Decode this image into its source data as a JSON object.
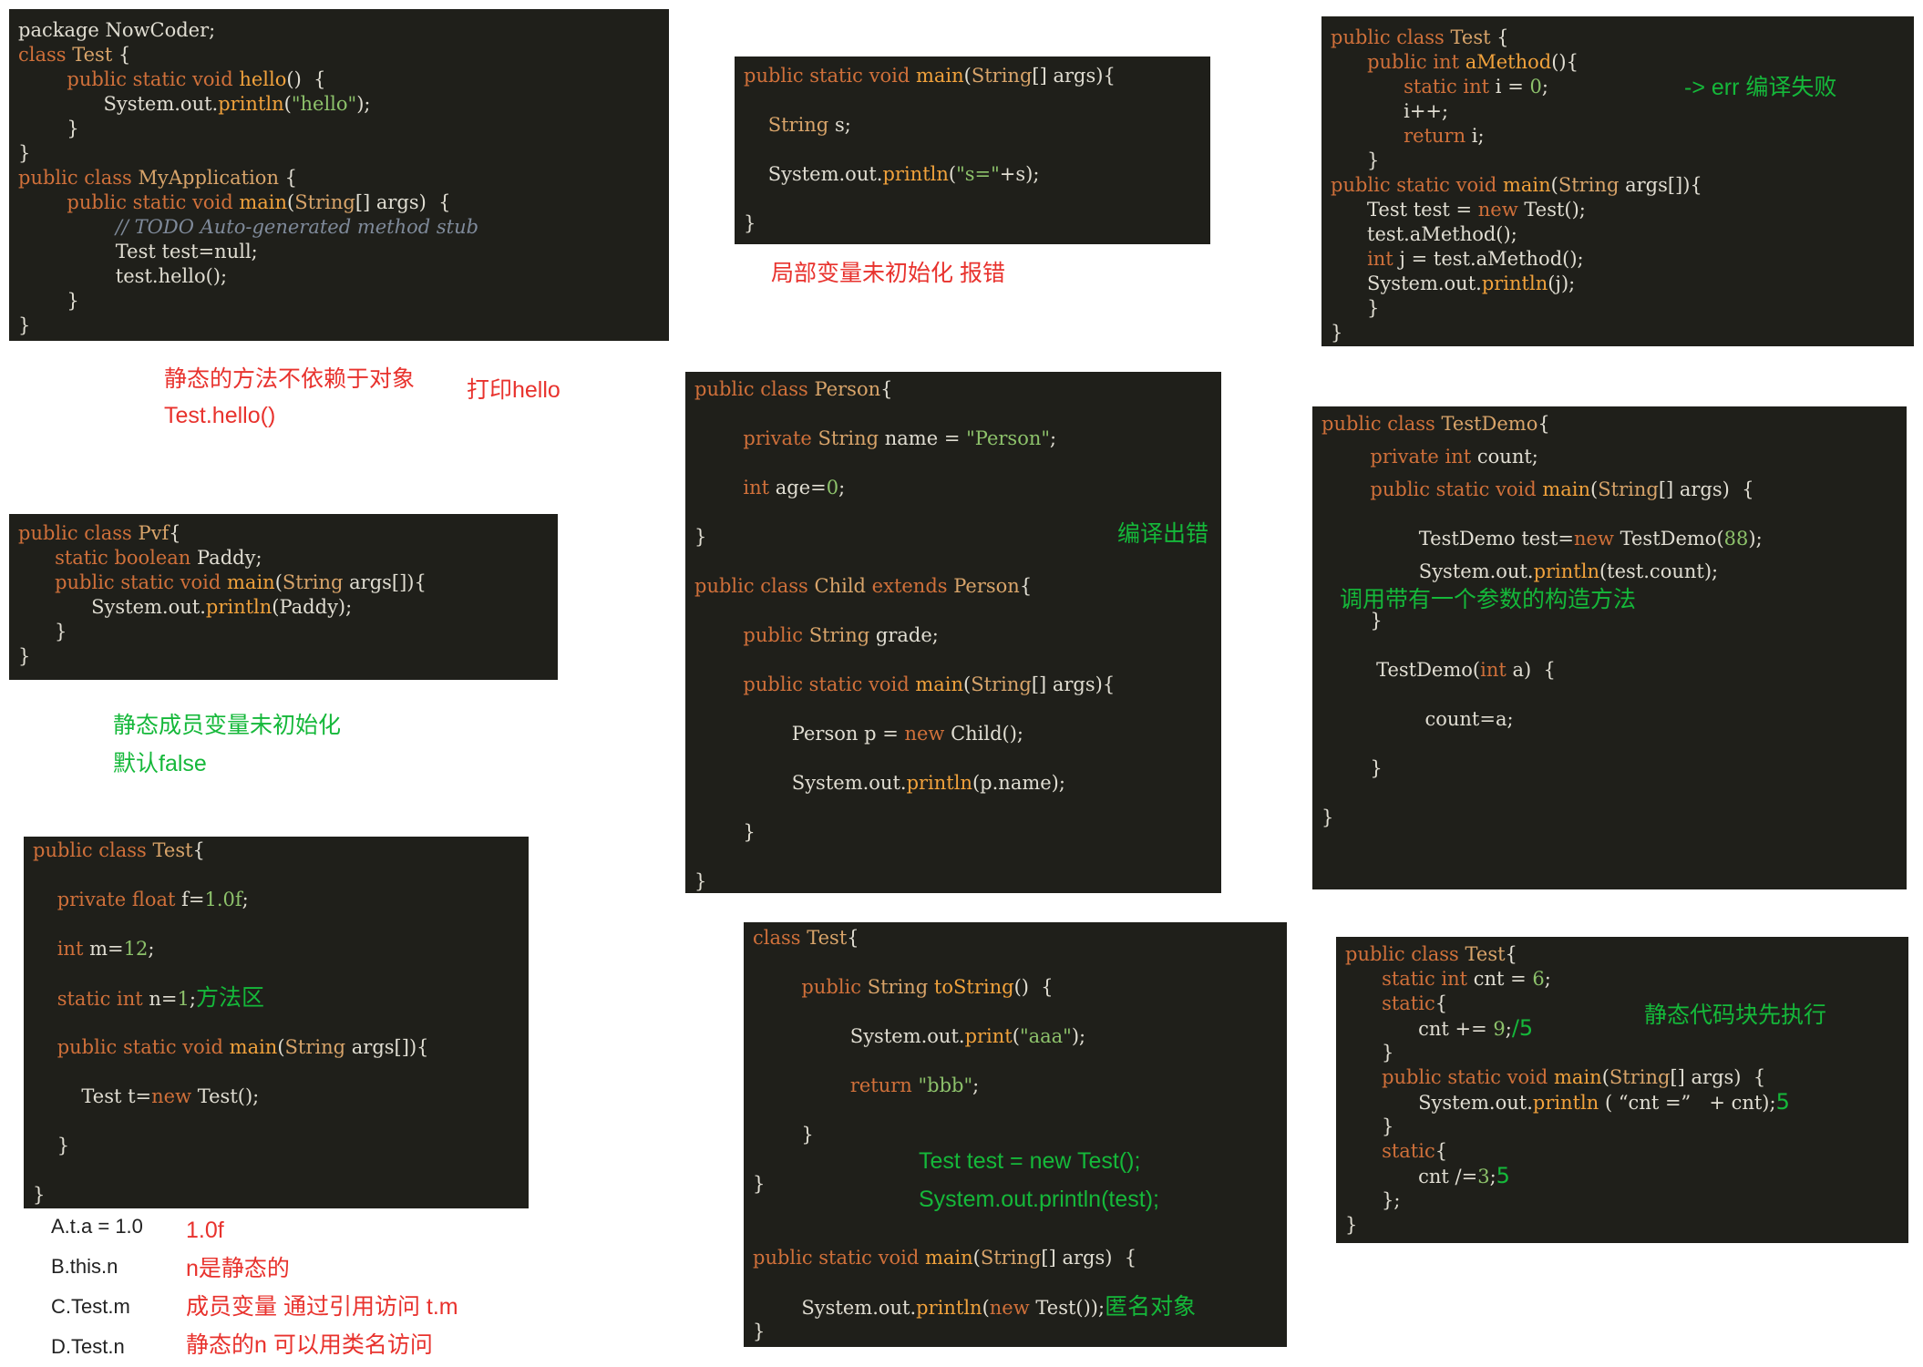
{
  "panels": [
    {
      "id": "p1",
      "lines": [
        [
          [
            "b",
            "package NowCoder;"
          ]
        ],
        [
          [
            "k",
            "class "
          ],
          [
            "t",
            "Test "
          ],
          [
            "b",
            "{"
          ]
        ],
        [
          [
            "b",
            "        "
          ],
          [
            "k",
            "public static void "
          ],
          [
            "m",
            "hello"
          ],
          [
            "b",
            "()  {"
          ]
        ],
        [
          [
            "b",
            "              System.out."
          ],
          [
            "m",
            "println"
          ],
          [
            "b",
            "("
          ],
          [
            "s",
            "\"hello\""
          ],
          [
            "b",
            ");"
          ]
        ],
        [
          [
            "b",
            "        }"
          ]
        ],
        [
          [
            "b",
            "}"
          ]
        ],
        [
          [
            "k",
            "public class "
          ],
          [
            "t",
            "MyApplication "
          ],
          [
            "b",
            "{"
          ]
        ],
        [
          [
            "b",
            "        "
          ],
          [
            "k",
            "public static void "
          ],
          [
            "m",
            "main"
          ],
          [
            "b",
            "("
          ],
          [
            "t",
            "String"
          ],
          [
            "b",
            "[] args)  {"
          ]
        ],
        [
          [
            "b",
            "                "
          ],
          [
            "c",
            "// TODO Auto-generated method stub"
          ]
        ],
        [
          [
            "b",
            "                Test test=null;"
          ]
        ],
        [
          [
            "b",
            "                test.hello();"
          ]
        ],
        [
          [
            "b",
            "        }"
          ]
        ],
        [
          [
            "b",
            "}"
          ]
        ]
      ]
    },
    {
      "id": "p2",
      "lines": [
        [
          [
            "k",
            "public static void "
          ],
          [
            "m",
            "main"
          ],
          [
            "b",
            "("
          ],
          [
            "t",
            "String"
          ],
          [
            "b",
            "[] args){"
          ]
        ],
        [],
        [
          [
            "b",
            "    "
          ],
          [
            "t",
            "String "
          ],
          [
            "b",
            "s;"
          ]
        ],
        [],
        [
          [
            "b",
            "    System.out."
          ],
          [
            "m",
            "println"
          ],
          [
            "b",
            "("
          ],
          [
            "s",
            "\"s=\""
          ],
          [
            "b",
            "+s);"
          ]
        ],
        [],
        [
          [
            "b",
            "}"
          ]
        ]
      ]
    },
    {
      "id": "p3",
      "lines": [
        [
          [
            "k",
            "public class "
          ],
          [
            "t",
            "Test "
          ],
          [
            "b",
            "{"
          ]
        ],
        [
          [
            "b",
            "      "
          ],
          [
            "k",
            "public int "
          ],
          [
            "m",
            "aMethod"
          ],
          [
            "b",
            "(){"
          ]
        ],
        [
          [
            "b",
            "            "
          ],
          [
            "k",
            "static int "
          ],
          [
            "b",
            "i = "
          ],
          [
            "n",
            "0"
          ],
          [
            "b",
            ";"
          ]
        ],
        [
          [
            "b",
            "            i++;"
          ]
        ],
        [
          [
            "b",
            "            "
          ],
          [
            "k",
            "return "
          ],
          [
            "b",
            "i;"
          ]
        ],
        [
          [
            "b",
            "      }"
          ]
        ],
        [
          [
            "k",
            "public static void "
          ],
          [
            "m",
            "main"
          ],
          [
            "b",
            "("
          ],
          [
            "t",
            "String "
          ],
          [
            "b",
            "args[]){"
          ]
        ],
        [
          [
            "b",
            "      Test test = "
          ],
          [
            "k",
            "new "
          ],
          [
            "b",
            "Test();"
          ]
        ],
        [
          [
            "b",
            "      test.aMethod();"
          ]
        ],
        [
          [
            "b",
            "      "
          ],
          [
            "k",
            "int "
          ],
          [
            "b",
            "j = test.aMethod();"
          ]
        ],
        [
          [
            "b",
            "      System.out."
          ],
          [
            "m",
            "println"
          ],
          [
            "b",
            "(j);"
          ]
        ],
        [
          [
            "b",
            "      }"
          ]
        ],
        [
          [
            "b",
            "}"
          ]
        ]
      ]
    },
    {
      "id": "p4",
      "lines": [
        [
          [
            "k",
            "public class "
          ],
          [
            "t",
            "Pvf"
          ],
          [
            "b",
            "{"
          ]
        ],
        [
          [
            "b",
            "      "
          ],
          [
            "k",
            "static boolean "
          ],
          [
            "b",
            "Paddy;"
          ]
        ],
        [
          [
            "b",
            "      "
          ],
          [
            "k",
            "public static void "
          ],
          [
            "m",
            "main"
          ],
          [
            "b",
            "("
          ],
          [
            "t",
            "String "
          ],
          [
            "b",
            "args[]){"
          ]
        ],
        [
          [
            "b",
            "            System.out."
          ],
          [
            "m",
            "println"
          ],
          [
            "b",
            "(Paddy);"
          ]
        ],
        [
          [
            "b",
            "      }"
          ]
        ],
        [
          [
            "b",
            "}"
          ]
        ]
      ]
    },
    {
      "id": "p5",
      "lines": [
        [
          [
            "k",
            "public class "
          ],
          [
            "t",
            "Person"
          ],
          [
            "b",
            "{"
          ]
        ],
        [],
        [
          [
            "b",
            "        "
          ],
          [
            "k",
            "private "
          ],
          [
            "t",
            "String "
          ],
          [
            "b",
            "name = "
          ],
          [
            "s",
            "\"Person\""
          ],
          [
            "b",
            ";"
          ]
        ],
        [],
        [
          [
            "b",
            "        "
          ],
          [
            "k",
            "int "
          ],
          [
            "b",
            "age="
          ],
          [
            "n",
            "0"
          ],
          [
            "b",
            ";"
          ]
        ],
        [],
        [
          [
            "b",
            "}"
          ]
        ],
        [],
        [
          [
            "k",
            "public class "
          ],
          [
            "t",
            "Child "
          ],
          [
            "k",
            "extends "
          ],
          [
            "t",
            "Person"
          ],
          [
            "b",
            "{"
          ]
        ],
        [],
        [
          [
            "b",
            "        "
          ],
          [
            "k",
            "public "
          ],
          [
            "t",
            "String "
          ],
          [
            "b",
            "grade;"
          ]
        ],
        [],
        [
          [
            "b",
            "        "
          ],
          [
            "k",
            "public static void "
          ],
          [
            "m",
            "main"
          ],
          [
            "b",
            "("
          ],
          [
            "t",
            "String"
          ],
          [
            "b",
            "[] args){"
          ]
        ],
        [],
        [
          [
            "b",
            "                Person p = "
          ],
          [
            "k",
            "new "
          ],
          [
            "b",
            "Child();"
          ]
        ],
        [],
        [
          [
            "b",
            "                System.out."
          ],
          [
            "m",
            "println"
          ],
          [
            "b",
            "(p.name);"
          ]
        ],
        [],
        [
          [
            "b",
            "        }"
          ]
        ],
        [],
        [
          [
            "b",
            "}"
          ]
        ]
      ]
    },
    {
      "id": "p6",
      "lines": [
        [
          [
            "k",
            "public class "
          ],
          [
            "t",
            "TestDemo"
          ],
          [
            "b",
            "{"
          ]
        ],
        [],
        [
          [
            "b",
            "        "
          ],
          [
            "k",
            "private int "
          ],
          [
            "b",
            "count;"
          ]
        ],
        [],
        [
          [
            "b",
            "        "
          ],
          [
            "k",
            "public static void "
          ],
          [
            "m",
            "main"
          ],
          [
            "b",
            "("
          ],
          [
            "t",
            "String"
          ],
          [
            "b",
            "[] args)  {"
          ]
        ],
        [],
        [],
        [
          [
            "b",
            "                TestDemo test="
          ],
          [
            "k",
            "new "
          ],
          [
            "b",
            "TestDemo("
          ],
          [
            "n",
            "88"
          ],
          [
            "b",
            ");"
          ]
        ],
        [],
        [
          [
            "b",
            "                System.out."
          ],
          [
            "m",
            "println"
          ],
          [
            "b",
            "(test.count);"
          ]
        ],
        [],
        [],
        [
          [
            "b",
            "        }"
          ]
        ],
        [],
        [],
        [
          [
            "b",
            "         TestDemo("
          ],
          [
            "k",
            "int "
          ],
          [
            "b",
            "a)  {"
          ]
        ],
        [],
        [],
        [
          [
            "b",
            "                 count=a;"
          ]
        ],
        [],
        [],
        [
          [
            "b",
            "        }"
          ]
        ],
        [],
        [],
        [
          [
            "b",
            "}"
          ]
        ]
      ]
    },
    {
      "id": "p7",
      "lines": [
        [
          [
            "k",
            "public class "
          ],
          [
            "t",
            "Test"
          ],
          [
            "b",
            "{"
          ]
        ],
        [],
        [
          [
            "b",
            "    "
          ],
          [
            "k",
            "private float "
          ],
          [
            "b",
            "f="
          ],
          [
            "n",
            "1.0f"
          ],
          [
            "b",
            ";"
          ]
        ],
        [],
        [
          [
            "b",
            "    "
          ],
          [
            "k",
            "int "
          ],
          [
            "b",
            "m="
          ],
          [
            "n",
            "12"
          ],
          [
            "b",
            ";"
          ]
        ],
        [],
        [
          [
            "b",
            "    "
          ],
          [
            "k",
            "static int "
          ],
          [
            "b",
            "n="
          ],
          [
            "n",
            "1"
          ],
          [
            "b",
            ";"
          ],
          [
            "note",
            "方法区"
          ]
        ],
        [],
        [
          [
            "b",
            "    "
          ],
          [
            "k",
            "public static void "
          ],
          [
            "m",
            "main"
          ],
          [
            "b",
            "("
          ],
          [
            "t",
            "String "
          ],
          [
            "b",
            "args[]){"
          ]
        ],
        [],
        [
          [
            "b",
            "        Test t="
          ],
          [
            "k",
            "new "
          ],
          [
            "b",
            "Test();"
          ]
        ],
        [],
        [
          [
            "b",
            "    }"
          ]
        ],
        [],
        [
          [
            "b",
            "}"
          ]
        ]
      ]
    },
    {
      "id": "p8",
      "lines": [
        [
          [
            "k",
            "class "
          ],
          [
            "t",
            "Test"
          ],
          [
            "b",
            "{"
          ]
        ],
        [],
        [
          [
            "b",
            "        "
          ],
          [
            "k",
            "public "
          ],
          [
            "t",
            "String "
          ],
          [
            "m",
            "toString"
          ],
          [
            "b",
            "()  {"
          ]
        ],
        [],
        [
          [
            "b",
            "                System.out."
          ],
          [
            "m",
            "print"
          ],
          [
            "b",
            "("
          ],
          [
            "s",
            "\"aaa\""
          ],
          [
            "b",
            ");"
          ]
        ],
        [],
        [
          [
            "b",
            "                "
          ],
          [
            "k",
            "return "
          ],
          [
            "s",
            "\"bbb\""
          ],
          [
            "b",
            ";"
          ]
        ],
        [],
        [
          [
            "b",
            "        }"
          ]
        ],
        [],
        [
          [
            "b",
            "}"
          ]
        ],
        [],
        [],
        [
          [
            "k",
            "public static void "
          ],
          [
            "m",
            "main"
          ],
          [
            "b",
            "("
          ],
          [
            "t",
            "String"
          ],
          [
            "b",
            "[] args)  {"
          ]
        ],
        [],
        [
          [
            "b",
            "        System.out."
          ],
          [
            "m",
            "println"
          ],
          [
            "b",
            "("
          ],
          [
            "k",
            "new "
          ],
          [
            "b",
            "Test());"
          ],
          [
            "note",
            "匿名对象"
          ]
        ],
        [
          [
            "b",
            "}"
          ]
        ]
      ]
    },
    {
      "id": "p9",
      "lines": [
        [
          [
            "k",
            "public class "
          ],
          [
            "t",
            "Test"
          ],
          [
            "b",
            "{"
          ]
        ],
        [
          [
            "b",
            "      "
          ],
          [
            "k",
            "static int "
          ],
          [
            "b",
            "cnt = "
          ],
          [
            "n",
            "6"
          ],
          [
            "b",
            ";"
          ]
        ],
        [
          [
            "b",
            "      "
          ],
          [
            "k",
            "static"
          ],
          [
            "b",
            "{"
          ]
        ],
        [
          [
            "b",
            "            cnt += "
          ],
          [
            "n",
            "9"
          ],
          [
            "b",
            ";"
          ],
          [
            "sw",
            "/5"
          ]
        ],
        [
          [
            "b",
            "      }"
          ]
        ],
        [
          [
            "b",
            "      "
          ],
          [
            "k",
            "public static void "
          ],
          [
            "m",
            "main"
          ],
          [
            "b",
            "("
          ],
          [
            "t",
            "String"
          ],
          [
            "b",
            "[] args)  {"
          ]
        ],
        [
          [
            "b",
            "            System.out."
          ],
          [
            "m",
            "println "
          ],
          [
            "b",
            "( “cnt =”   + cnt);"
          ],
          [
            "sw",
            "5"
          ]
        ],
        [
          [
            "b",
            "      }"
          ]
        ],
        [
          [
            "b",
            "      "
          ],
          [
            "k",
            "static"
          ],
          [
            "b",
            "{"
          ]
        ],
        [
          [
            "b",
            "            cnt /="
          ],
          [
            "n",
            "3"
          ],
          [
            "b",
            ";"
          ],
          [
            "sw",
            "5"
          ]
        ],
        [
          [
            "b",
            "      };"
          ]
        ],
        [
          [
            "b",
            "}"
          ]
        ]
      ]
    }
  ],
  "notes": {
    "n1": "静态的方法不依赖于对象",
    "n2": "Test.hello()",
    "n3": "打印hello",
    "n4": "局部变量未初始化 报错",
    "n5": "-> err  编译失败",
    "n6": "编译出错",
    "n7": "调用带有一个参数的构造方法",
    "n8": "静态成员变量未初始化",
    "n9": "默认false",
    "n10": "静态代码块先执行",
    "n11": "Test test = new Test();",
    "n12": "System.out.println(test);"
  },
  "options": {
    "a": "A.t.a = 1.0",
    "b": "B.this.n",
    "c": "C.Test.m",
    "d": "D.Test.n",
    "a_note": "1.0f",
    "b_note": "n是静态的",
    "c_note": "成员变量 通过引用访问 t.m",
    "d_note": "静态的n 可以用类名访问"
  }
}
